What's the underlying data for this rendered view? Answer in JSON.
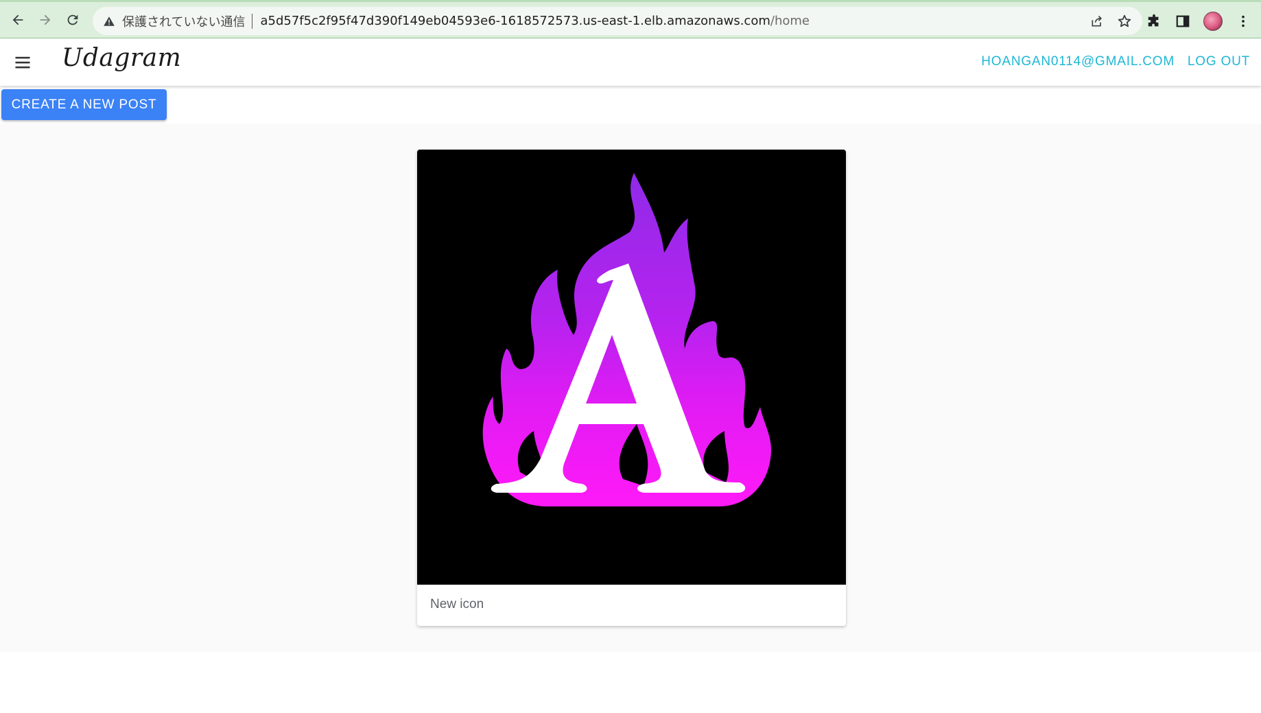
{
  "browser": {
    "not_secure_label": "保護されていない通信",
    "url_host": "a5d57f5c2f95f47d390f149eb04593e6-1618572573.us-east-1.elb.amazonaws.com",
    "url_path": "/home",
    "theme_color": "#dcefdc"
  },
  "header": {
    "title": "Udagram",
    "user_email": "HOANGAN0114@GMAIL.COM",
    "logout_label": "LOG OUT",
    "accent_color": "#1fb6d6"
  },
  "actions": {
    "create_post_label": "CREATE A NEW POST",
    "button_color": "#3b82f6"
  },
  "feed": {
    "posts": [
      {
        "image_icon": "flaming-letter-a",
        "caption": "New icon"
      }
    ]
  }
}
